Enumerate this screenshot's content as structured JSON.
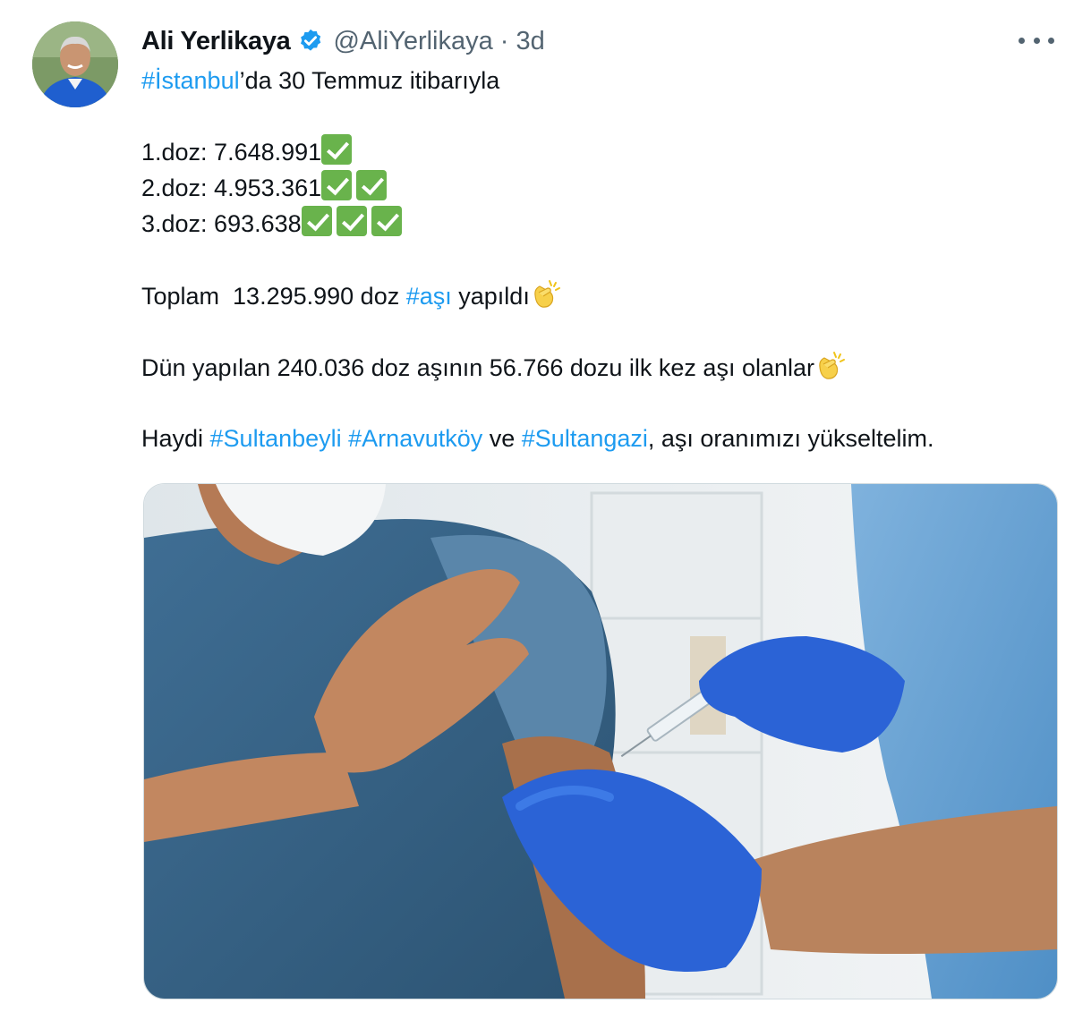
{
  "tweet": {
    "author": {
      "display_name": "Ali Yerlikaya",
      "handle": "@AliYerlikaya",
      "separator": "·",
      "time": "3d",
      "verified": true
    },
    "more_icon": "more-horizontal-icon",
    "text": {
      "line1": {
        "hashtag": "#İstanbul",
        "rest": "’da 30 Temmuz itibarıyla"
      },
      "dose1": {
        "text": "1.doz: 7.648.991",
        "checks": 1
      },
      "dose2": {
        "text": "2.doz: 4.953.361",
        "checks": 2
      },
      "dose3": {
        "text": "3.doz: 693.638",
        "checks": 3
      },
      "total": {
        "pre": "Toplam  13.295.990 doz ",
        "hashtag": "#aşı",
        "post": " yapıldı"
      },
      "yesterday": {
        "text": "Dün yapılan 240.036 doz aşının 56.766 dozu ilk kez aşı olanlar"
      },
      "call": {
        "pre": "Haydi ",
        "tag1": "#Sultanbeyli",
        "tag2": "#Arnavutköy",
        "mid": " ve ",
        "tag3": "#Sultangazi",
        "post": ", aşı oranımızı yükseltelim."
      }
    },
    "emoji": {
      "check": "check-mark-button-icon",
      "clap": "clapping-hands-icon"
    },
    "colors": {
      "link": "#1d9bf0",
      "secondary": "#536471",
      "verified": "#1d9bf0",
      "check_bg": "#69b34c"
    }
  }
}
